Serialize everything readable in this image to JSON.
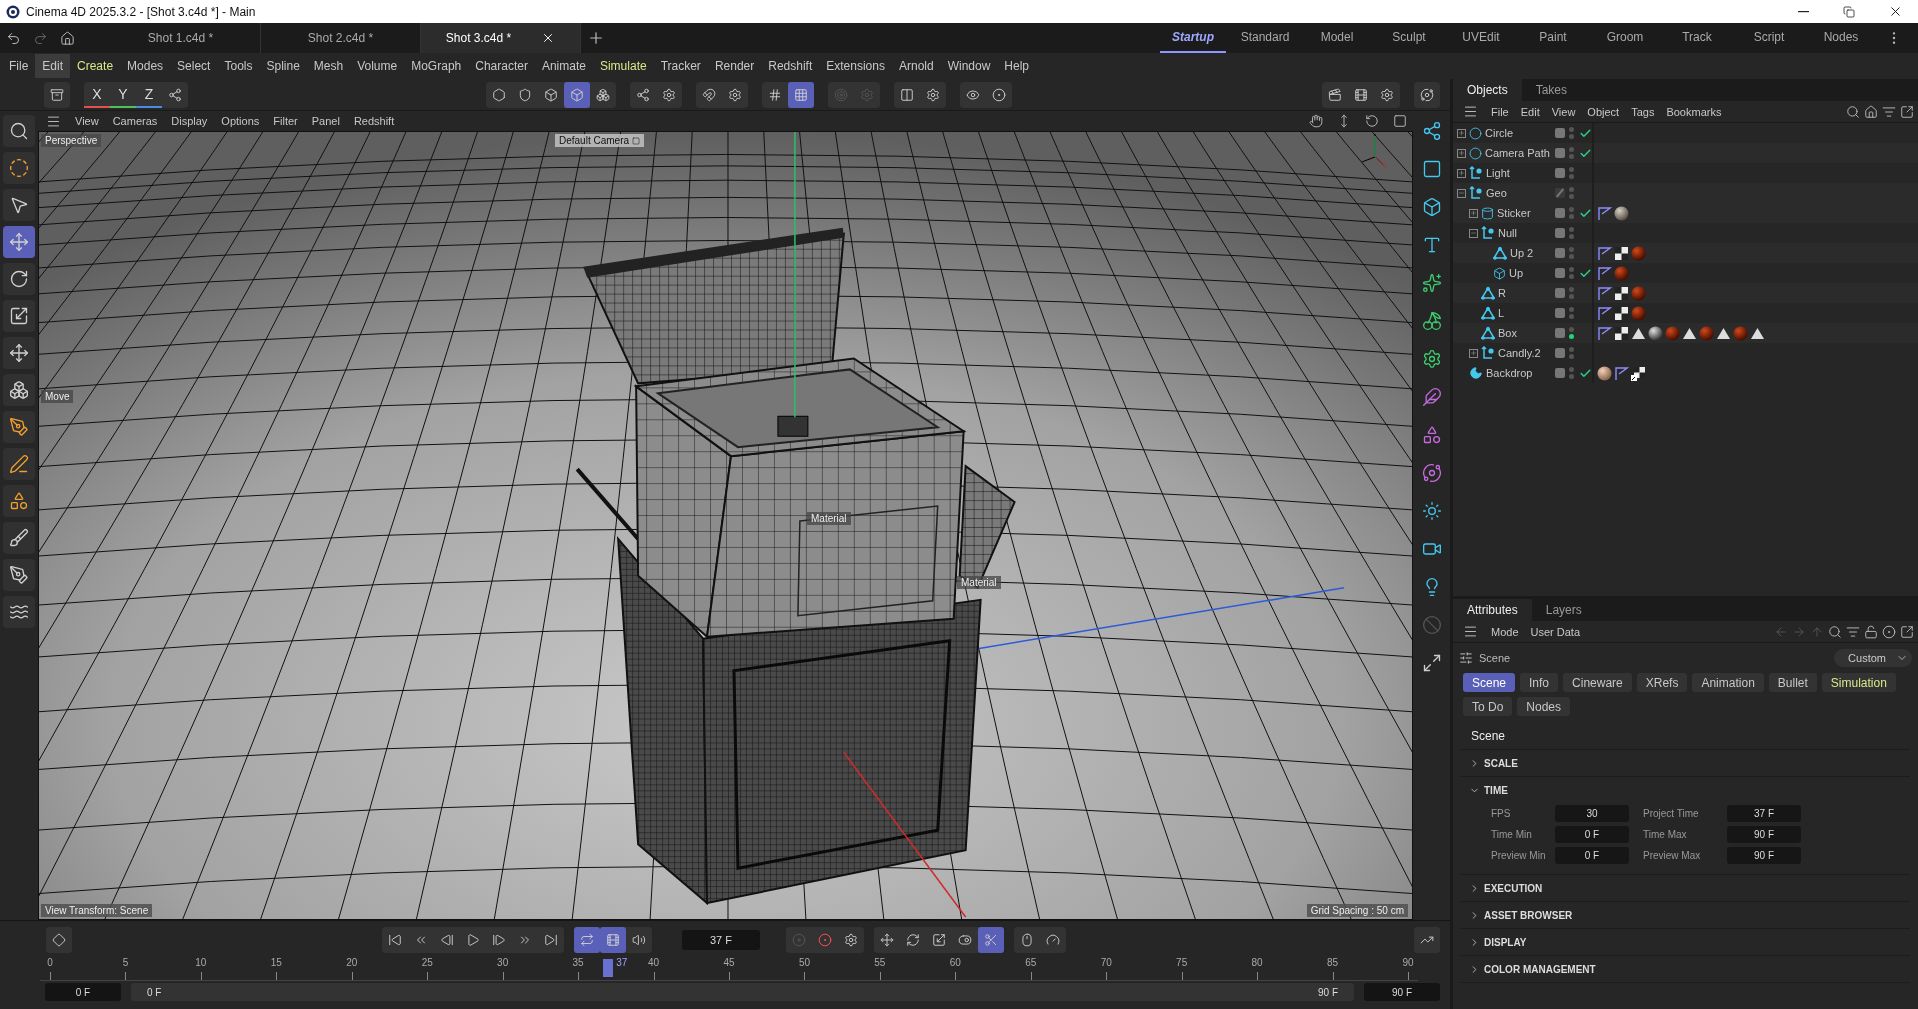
{
  "window": {
    "title": "Cinema 4D 2025.3.2 - [Shot 3.c4d *] - Main"
  },
  "document_tabs": [
    {
      "label": "Shot 1.c4d *",
      "selected": false
    },
    {
      "label": "Shot 2.c4d *",
      "selected": false
    },
    {
      "label": "Shot 3.c4d *",
      "selected": true
    }
  ],
  "layout_tabs": [
    {
      "label": "Startup",
      "selected": true
    },
    {
      "label": "Standard",
      "selected": false
    },
    {
      "label": "Model",
      "selected": false
    },
    {
      "label": "Sculpt",
      "selected": false
    },
    {
      "label": "UVEdit",
      "selected": false
    },
    {
      "label": "Paint",
      "selected": false
    },
    {
      "label": "Groom",
      "selected": false
    },
    {
      "label": "Track",
      "selected": false
    },
    {
      "label": "Script",
      "selected": false
    },
    {
      "label": "Nodes",
      "selected": false
    }
  ],
  "menu": [
    {
      "label": "File",
      "selected": false,
      "color": "#c8c8c8"
    },
    {
      "label": "Edit",
      "selected": true,
      "color": "#c8c8c8"
    },
    {
      "label": "Create",
      "selected": false,
      "color": "#d8e88a"
    },
    {
      "label": "Modes",
      "selected": false,
      "color": "#c8c8c8"
    },
    {
      "label": "Select",
      "selected": false,
      "color": "#c8c8c8"
    },
    {
      "label": "Tools",
      "selected": false,
      "color": "#c8c8c8"
    },
    {
      "label": "Spline",
      "selected": false,
      "color": "#c8c8c8"
    },
    {
      "label": "Mesh",
      "selected": false,
      "color": "#c8c8c8"
    },
    {
      "label": "Volume",
      "selected": false,
      "color": "#c8c8c8"
    },
    {
      "label": "MoGraph",
      "selected": false,
      "color": "#c8c8c8"
    },
    {
      "label": "Character",
      "selected": false,
      "color": "#c8c8c8"
    },
    {
      "label": "Animate",
      "selected": false,
      "color": "#c8c8c8"
    },
    {
      "label": "Simulate",
      "selected": false,
      "color": "#d8e88a"
    },
    {
      "label": "Tracker",
      "selected": false,
      "color": "#c8c8c8"
    },
    {
      "label": "Render",
      "selected": false,
      "color": "#c8c8c8"
    },
    {
      "label": "Redshift",
      "selected": false,
      "color": "#c8c8c8"
    },
    {
      "label": "Extensions",
      "selected": false,
      "color": "#c8c8c8"
    },
    {
      "label": "Arnold",
      "selected": false,
      "color": "#c8c8c8"
    },
    {
      "label": "Window",
      "selected": false,
      "color": "#c8c8c8"
    },
    {
      "label": "Help",
      "selected": false,
      "color": "#c8c8c8"
    }
  ],
  "axis_buttons": [
    {
      "label": "X",
      "color": "#e05252"
    },
    {
      "label": "Y",
      "color": "#4fc05a"
    },
    {
      "label": "Z",
      "color": "#4a8ae6"
    }
  ],
  "viewport": {
    "menu": [
      "View",
      "Cameras",
      "Display",
      "Options",
      "Filter",
      "Panel",
      "Redshift"
    ],
    "view_label": "Perspective",
    "camera_label": "Default Camera",
    "tool_label": "Move",
    "object_labels": [
      "Material",
      "Material"
    ],
    "status_left": "View Transform: Scene",
    "status_right": "Grid Spacing : 50 cm"
  },
  "objects": {
    "tabs": [
      {
        "label": "Objects",
        "selected": true
      },
      {
        "label": "Takes",
        "selected": false
      }
    ],
    "menu": [
      "File",
      "Edit",
      "View",
      "Object",
      "Tags",
      "Bookmarks"
    ],
    "tree": [
      {
        "name": "Circle",
        "kind": "circle",
        "expanded": false,
        "enabled": true,
        "active": false,
        "layer_locked": false
      },
      {
        "name": "Camera Path",
        "kind": "circle",
        "expanded": false,
        "enabled": true,
        "active": false,
        "layer_locked": false
      },
      {
        "name": "Light",
        "kind": "null",
        "expanded": false,
        "enabled": false,
        "active": false,
        "layer_locked": false
      },
      {
        "name": "Geo",
        "kind": "null",
        "expanded": true,
        "enabled": false,
        "active": false,
        "layer_locked": true,
        "children": [
          {
            "name": "Sticker",
            "kind": "cylinder",
            "expanded": false,
            "enabled": true,
            "active": false,
            "layer_locked": false,
            "tags": [
              {
                "kind": "phong"
              },
              {
                "kind": "sticker"
              }
            ]
          },
          {
            "name": "Null",
            "kind": "null",
            "expanded": true,
            "enabled": false,
            "active": false,
            "layer_locked": false,
            "children": [
              {
                "name": "Up 2",
                "kind": "joint",
                "enabled": false,
                "active": false,
                "layer_locked": false,
                "tags": [
                  {
                    "kind": "phong"
                  },
                  {
                    "kind": "checker"
                  },
                  {
                    "kind": "red"
                  }
                ]
              },
              {
                "name": "Up",
                "kind": "cube",
                "enabled": true,
                "active": false,
                "layer_locked": false,
                "tags": [
                  {
                    "kind": "phong"
                  },
                  {
                    "kind": "red"
                  }
                ]
              }
            ]
          },
          {
            "name": "R",
            "kind": "joint",
            "enabled": false,
            "active": false,
            "layer_locked": false,
            "tags": [
              {
                "kind": "phong"
              },
              {
                "kind": "checker"
              },
              {
                "kind": "red"
              }
            ]
          },
          {
            "name": "L",
            "kind": "joint",
            "enabled": false,
            "active": false,
            "layer_locked": false,
            "tags": [
              {
                "kind": "phong"
              },
              {
                "kind": "checker"
              },
              {
                "kind": "red"
              }
            ]
          },
          {
            "name": "Box",
            "kind": "joint",
            "enabled": false,
            "active": true,
            "layer_locked": false,
            "tags": [
              {
                "kind": "phong"
              },
              {
                "kind": "checker"
              },
              {
                "kind": "triangle"
              },
              {
                "kind": "grey"
              },
              {
                "kind": "red"
              },
              {
                "kind": "triangle"
              },
              {
                "kind": "red"
              },
              {
                "kind": "triangle"
              },
              {
                "kind": "red"
              },
              {
                "kind": "triangle"
              }
            ]
          },
          {
            "name": "Candly.2",
            "kind": "null",
            "expanded": false,
            "enabled": false,
            "active": false,
            "layer_locked": false
          }
        ]
      },
      {
        "name": "Backdrop",
        "kind": "backdrop",
        "enabled": true,
        "active": false,
        "layer_locked": false,
        "tags": [
          {
            "kind": "skin"
          },
          {
            "kind": "phong"
          },
          {
            "kind": "display"
          }
        ]
      }
    ]
  },
  "attributes": {
    "tabs": [
      {
        "label": "Attributes",
        "selected": true
      },
      {
        "label": "Layers",
        "selected": false
      }
    ],
    "menu": [
      "Mode",
      "User Data"
    ],
    "mode": "Scene",
    "preset": "Custom",
    "subtabs": [
      {
        "label": "Scene",
        "selected": true,
        "kind": "plain"
      },
      {
        "label": "Info",
        "selected": false,
        "kind": "plain"
      },
      {
        "label": "Cineware",
        "selected": false,
        "kind": "plain"
      },
      {
        "label": "XRefs",
        "selected": false,
        "kind": "plain"
      },
      {
        "label": "Animation",
        "selected": false,
        "kind": "plain"
      },
      {
        "label": "Bullet",
        "selected": false,
        "kind": "plain"
      },
      {
        "label": "Simulation",
        "selected": false,
        "kind": "highlight"
      },
      {
        "label": "To Do",
        "selected": false,
        "kind": "plain"
      },
      {
        "label": "Nodes",
        "selected": false,
        "kind": "plain"
      }
    ],
    "heading": "Scene",
    "sections": [
      {
        "title": "SCALE",
        "expanded": false
      },
      {
        "title": "TIME",
        "expanded": true,
        "rows": [
          [
            {
              "label": "FPS",
              "value": "30"
            },
            {
              "label": "Project Time",
              "value": "37 F"
            }
          ],
          [
            {
              "label": "Time Min",
              "value": "0 F"
            },
            {
              "label": "Time Max",
              "value": "90 F"
            }
          ],
          [
            {
              "label": "Preview Min",
              "value": "0 F"
            },
            {
              "label": "Preview Max",
              "value": "90 F"
            }
          ]
        ]
      },
      {
        "title": "EXECUTION",
        "expanded": false
      },
      {
        "title": "ASSET BROWSER",
        "expanded": false
      },
      {
        "title": "DISPLAY",
        "expanded": false
      },
      {
        "title": "COLOR MANAGEMENT",
        "expanded": false
      }
    ]
  },
  "timeline": {
    "current_frame": "37 F",
    "ticks": [
      "0",
      "5",
      "10",
      "15",
      "20",
      "25",
      "30",
      "35",
      "40",
      "45",
      "50",
      "55",
      "60",
      "65",
      "70",
      "75",
      "80",
      "85",
      "90"
    ],
    "playhead": {
      "label": "37",
      "level": 0.411
    },
    "start_field": "0 F",
    "range_start": "0 F",
    "range_end": "90 F",
    "end_field": "90 F"
  }
}
